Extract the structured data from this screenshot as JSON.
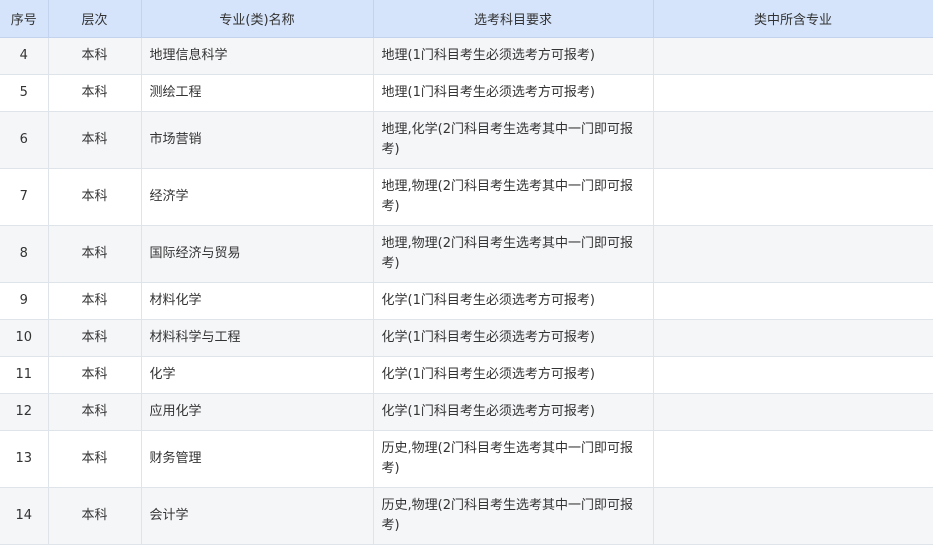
{
  "headers": {
    "no": "序号",
    "level": "层次",
    "name": "专业(类)名称",
    "requirement": "选考科目要求",
    "sub_majors": "类中所含专业"
  },
  "rows": [
    {
      "no": "4",
      "level": "本科",
      "name": "地理信息科学",
      "requirement": "地理(1门科目考生必须选考方可报考)",
      "sub_majors": ""
    },
    {
      "no": "5",
      "level": "本科",
      "name": "测绘工程",
      "requirement": "地理(1门科目考生必须选考方可报考)",
      "sub_majors": ""
    },
    {
      "no": "6",
      "level": "本科",
      "name": "市场营销",
      "requirement": "地理,化学(2门科目考生选考其中一门即可报考)",
      "sub_majors": ""
    },
    {
      "no": "7",
      "level": "本科",
      "name": "经济学",
      "requirement": "地理,物理(2门科目考生选考其中一门即可报考)",
      "sub_majors": ""
    },
    {
      "no": "8",
      "level": "本科",
      "name": "国际经济与贸易",
      "requirement": "地理,物理(2门科目考生选考其中一门即可报考)",
      "sub_majors": ""
    },
    {
      "no": "9",
      "level": "本科",
      "name": "材料化学",
      "requirement": "化学(1门科目考生必须选考方可报考)",
      "sub_majors": ""
    },
    {
      "no": "10",
      "level": "本科",
      "name": "材料科学与工程",
      "requirement": "化学(1门科目考生必须选考方可报考)",
      "sub_majors": ""
    },
    {
      "no": "11",
      "level": "本科",
      "name": "化学",
      "requirement": "化学(1门科目考生必须选考方可报考)",
      "sub_majors": ""
    },
    {
      "no": "12",
      "level": "本科",
      "name": "应用化学",
      "requirement": "化学(1门科目考生必须选考方可报考)",
      "sub_majors": ""
    },
    {
      "no": "13",
      "level": "本科",
      "name": "财务管理",
      "requirement": "历史,物理(2门科目考生选考其中一门即可报考)",
      "sub_majors": ""
    },
    {
      "no": "14",
      "level": "本科",
      "name": "会计学",
      "requirement": "历史,物理(2门科目考生选考其中一门即可报考)",
      "sub_majors": ""
    }
  ]
}
